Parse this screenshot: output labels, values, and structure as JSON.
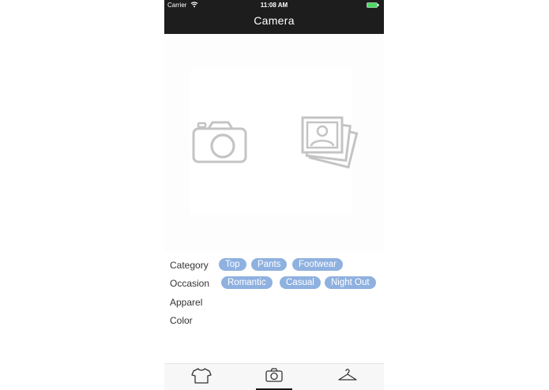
{
  "status_bar": {
    "carrier": "Carrier",
    "time": "11:08 AM",
    "wifi_icon": "wifi-icon",
    "battery_icon": "battery-icon"
  },
  "nav": {
    "title": "Camera"
  },
  "photo_picker": {
    "camera_icon": "camera-icon",
    "gallery_icon": "photo-gallery-icon"
  },
  "rows": [
    {
      "label": "Category",
      "tags": [
        "Top",
        "Pants",
        "Footwear"
      ]
    },
    {
      "label": "Occasion",
      "tags": [
        "Romantic",
        "Casual",
        "Night Out"
      ]
    },
    {
      "label": "Apparel",
      "tags": []
    },
    {
      "label": "Color",
      "tags": []
    }
  ],
  "tabbar": {
    "items": [
      {
        "icon": "tshirt-icon"
      },
      {
        "icon": "camera-icon",
        "selected": true
      },
      {
        "icon": "hanger-icon"
      }
    ]
  },
  "colors": {
    "header_bg": "#1d1d1d",
    "tag_bg": "#8fb1e0",
    "battery": "#4cd964",
    "icon_gray": "#c4c4c4"
  }
}
